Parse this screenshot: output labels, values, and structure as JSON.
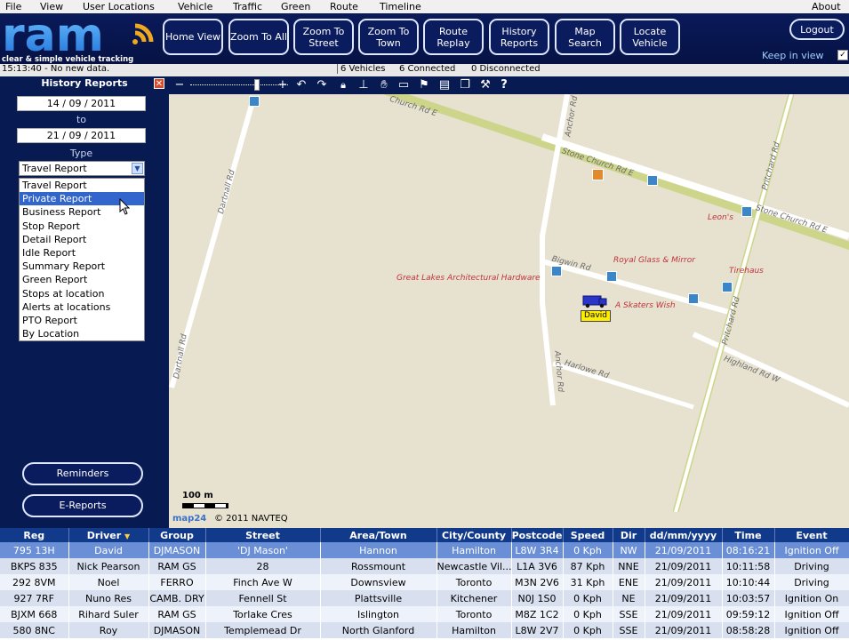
{
  "menu": [
    "File",
    "View",
    "User Locations",
    "Vehicle",
    "Traffic",
    "Green",
    "Route",
    "Timeline"
  ],
  "menu_right": "About",
  "logo": {
    "text": "ram",
    "tagline": "clear & simple vehicle tracking"
  },
  "nav": [
    {
      "label": "Home View"
    },
    {
      "label": "Zoom To All"
    },
    {
      "label": "Zoom To Street"
    },
    {
      "label": "Zoom To Town"
    },
    {
      "label": "Route Replay"
    },
    {
      "label": "History Reports"
    },
    {
      "label": "Map Search"
    },
    {
      "label": "Locate Vehicle"
    }
  ],
  "logout_label": "Logout",
  "keep_in_view_label": "Keep in view",
  "keep_in_view_checked": "✓",
  "status": {
    "time_msg": "15:13:40 - No new data.",
    "vehicles": "6 Vehicles",
    "connected": "6 Connected",
    "disconnected": "0 Disconnected"
  },
  "sidebar": {
    "title": "History Reports",
    "from_date": "14 / 09 / 2011",
    "to_label": "to",
    "to_date": "21 / 09 / 2011",
    "type_label": "Type",
    "type_value": "Travel Report",
    "type_options": [
      "Travel Report",
      "Private Report",
      "Business Report",
      "Stop Report",
      "Detail Report",
      "Idle Report",
      "Summary Report",
      "Green Report",
      "Stops at location",
      "Alerts at locations",
      "PTO Report",
      "By Location"
    ],
    "selected_option": "Private Report",
    "reminders_label": "Reminders",
    "ereports_label": "E-Reports"
  },
  "map": {
    "roads": [
      "Church Rd E",
      "Stone Church Rd E",
      "Stone Church Rd E",
      "Anchor Rd",
      "Anchor Rd",
      "Dartnall Rd",
      "Dartnall Rd",
      "Pritchard Rd",
      "Pritchard Rd",
      "Bigwin Rd",
      "Harlowe Rd",
      "Highland Rd W"
    ],
    "pois": [
      "Great Lakes Architectural Hardware",
      "Royal Glass & Mirror",
      "A Skaters Wish",
      "Leon's",
      "Tirehaus"
    ],
    "vehicle_label": "David",
    "scale_label": "100 m",
    "copyright": "© 2011 NAVTEQ",
    "brand": "map24"
  },
  "table": {
    "headers": [
      "Reg",
      "Driver",
      "Group",
      "Street",
      "Area/Town",
      "City/County",
      "Postcode",
      "Speed",
      "Dir",
      "dd/mm/yyyy",
      "Time",
      "Event"
    ],
    "rows": [
      [
        "795 13H",
        "David",
        "DJMASON",
        "'DJ Mason'",
        "Hannon",
        "Hamilton",
        "L8W 3R4",
        "0 Kph",
        "NW",
        "21/09/2011",
        "08:16:21",
        "Ignition Off"
      ],
      [
        "BKPS 835",
        "Nick Pearson",
        "RAM GS",
        "28",
        "Rossmount",
        "Newcastle Vil...",
        "L1A 3V6",
        "87 Kph",
        "NNE",
        "21/09/2011",
        "10:11:58",
        "Driving"
      ],
      [
        "292 8VM",
        "Noel",
        "FERRO",
        "Finch Ave W",
        "Downsview",
        "Toronto",
        "M3N 2V6",
        "31 Kph",
        "ENE",
        "21/09/2011",
        "10:10:44",
        "Driving"
      ],
      [
        "927 7RF",
        "Nuno Res",
        "CAMB. DRY",
        "Fennell St",
        "Plattsville",
        "Kitchener",
        "N0J 1S0",
        "0 Kph",
        "NE",
        "21/09/2011",
        "10:03:57",
        "Ignition On"
      ],
      [
        "BJXM 668",
        "Rihard Suler",
        "RAM GS",
        "Torlake Cres",
        "Islington",
        "Toronto",
        "M8Z 1C2",
        "0 Kph",
        "SSE",
        "21/09/2011",
        "09:59:12",
        "Ignition Off"
      ],
      [
        "580 8NC",
        "Roy",
        "DJMASON",
        "Templemead Dr",
        "North Glanford",
        "Hamilton",
        "L8W 2V7",
        "0 Kph",
        "SSE",
        "21/09/2011",
        "08:58:28",
        "Ignition Off"
      ]
    ]
  },
  "colors": {
    "header_bg": "#0a1a5a",
    "accent": "#123a8a",
    "selected_row": "#6a8fd6",
    "poi": "#c0323a"
  }
}
